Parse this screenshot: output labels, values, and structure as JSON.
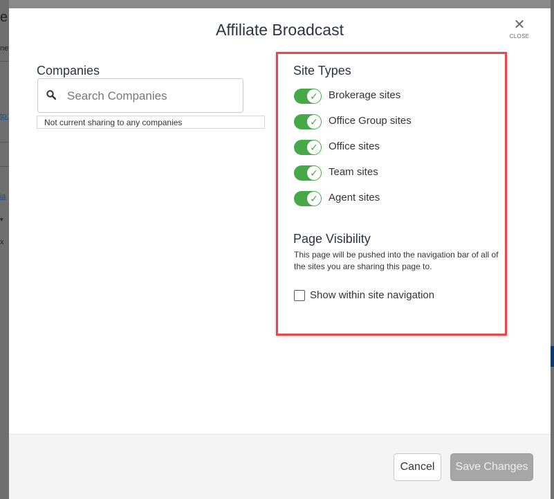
{
  "background": {
    "left_fragments": [
      "e",
      "ne",
      "tp:",
      "ia",
      "▾",
      "x"
    ]
  },
  "modal": {
    "title": "Affiliate Broadcast",
    "close_label": "CLOSE",
    "close_glyph": "✕"
  },
  "companies": {
    "title": "Companies",
    "search_placeholder": "Search Companies",
    "search_value": "",
    "status": "Not current sharing to any companies"
  },
  "site_types": {
    "title": "Site Types",
    "items": [
      {
        "label": "Brokerage sites",
        "enabled": true
      },
      {
        "label": "Office Group sites",
        "enabled": true
      },
      {
        "label": "Office sites",
        "enabled": true
      },
      {
        "label": "Team sites",
        "enabled": true
      },
      {
        "label": "Agent sites",
        "enabled": true
      }
    ]
  },
  "page_visibility": {
    "title": "Page Visibility",
    "description": "This page will be pushed into the navigation bar of all of the sites you are sharing this page to.",
    "checkbox_label": "Show within site navigation",
    "checked": false
  },
  "footer": {
    "cancel_label": "Cancel",
    "save_label": "Save Changes"
  },
  "colors": {
    "toggle_on": "#45a947",
    "highlight_border": "#e5484d",
    "save_disabled": "#a6a6a6"
  }
}
